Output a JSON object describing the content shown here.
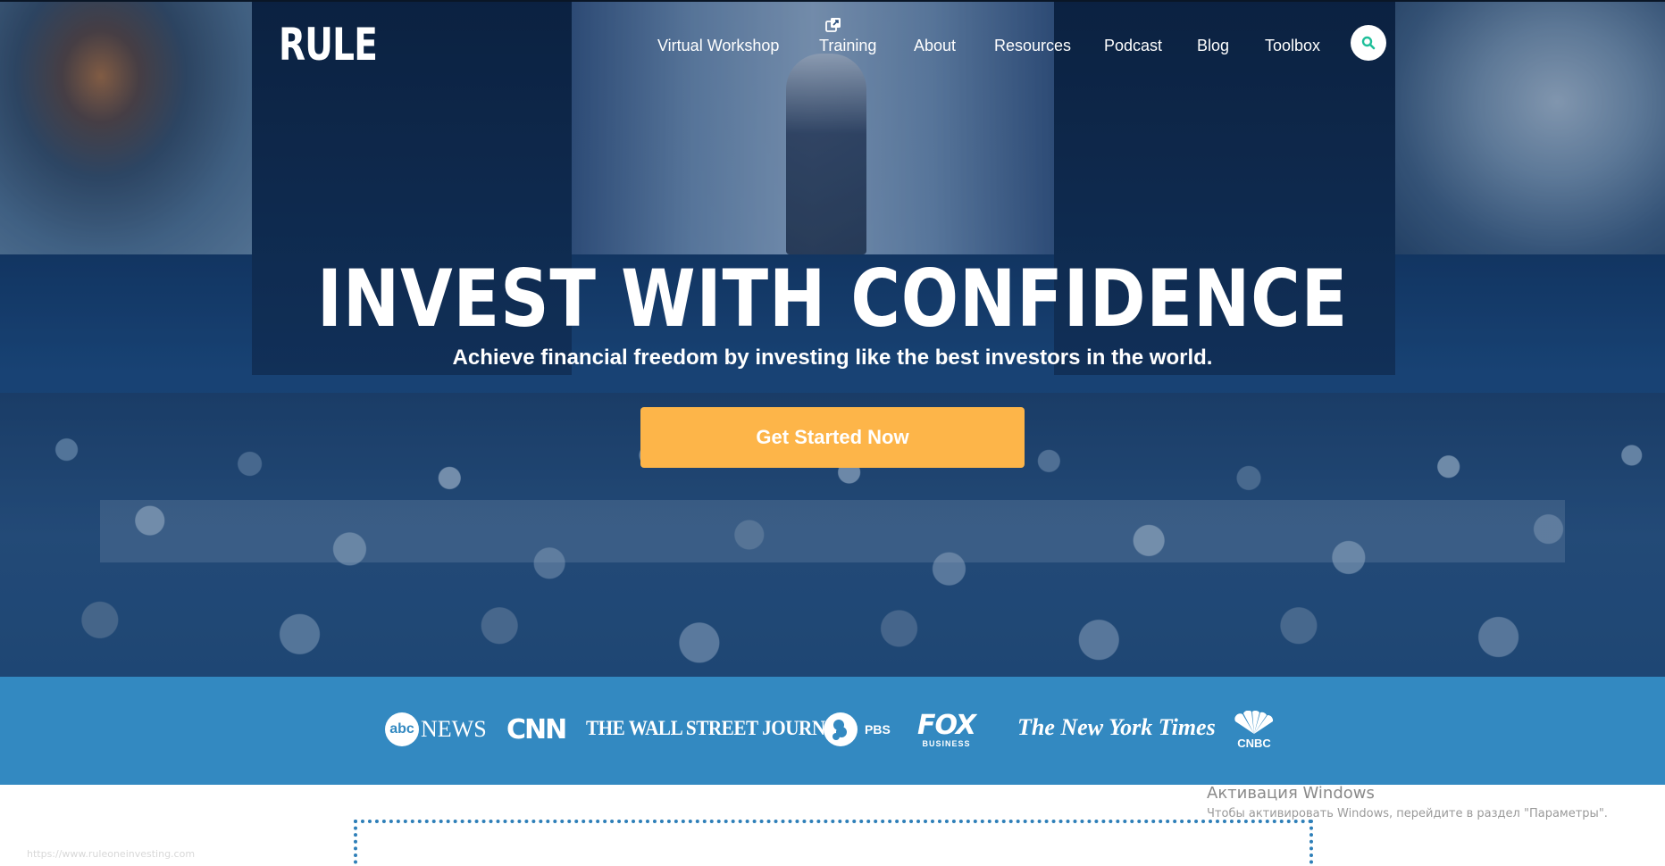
{
  "header": {
    "logo_text": "RULE",
    "nav": [
      {
        "label": "Virtual Workshop"
      },
      {
        "label": "Training"
      },
      {
        "label": "About"
      },
      {
        "label": "Resources"
      },
      {
        "label": "Podcast"
      },
      {
        "label": "Blog"
      },
      {
        "label": "Toolbox"
      }
    ],
    "search_icon": "search-icon",
    "training_icon": "external-window-icon"
  },
  "hero": {
    "title": "INVEST WITH CONFIDENCE",
    "subtitle": "Achieve financial freedom by investing like the best investors in the world.",
    "cta_label": "Get Started Now"
  },
  "media_logos": {
    "abc_circle": "abc",
    "abc_news": "NEWS",
    "cnn": "CNN",
    "wsj": "THE WALL STREET JOURNAL.",
    "pbs": "PBS",
    "fox": "FOX",
    "fox_sub": "BUSINESS",
    "nyt": "The New York Times",
    "cnbc": "CNBC"
  },
  "windows_activation": {
    "title": "Активация Windows",
    "subtitle": "Чтобы активировать Windows, перейдите в раздел \"Параметры\"."
  },
  "status_url": "https://www.ruleoneinvesting.com",
  "colors": {
    "accent_orange": "#fdb549",
    "media_bar_blue": "#3389c1",
    "search_icon_teal": "#1fbf9a"
  }
}
